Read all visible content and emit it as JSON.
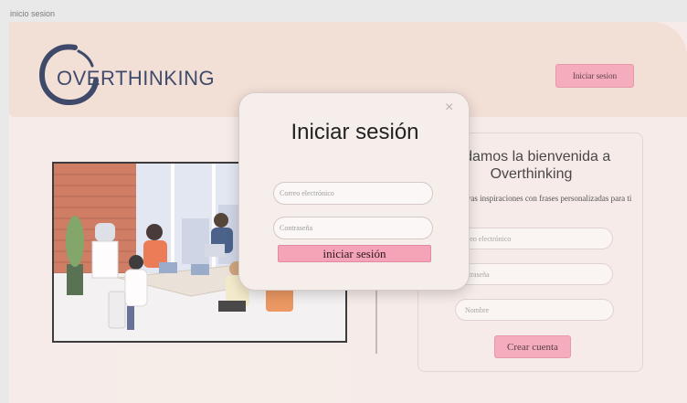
{
  "window": {
    "title": "inicio sesion"
  },
  "header": {
    "logo_text": "OVERTHINKING",
    "login_button": "Iniciar sesion"
  },
  "signup": {
    "title": "e damos la bienvenida a Overthinking",
    "subtitle": "entra nuevas inspiraciones con frases personalizadas para ti",
    "email_placeholder": "rreo electrónico",
    "password_placeholder": "ntraseña",
    "name_placeholder": "Nombre",
    "create_button": "Crear cuenta"
  },
  "modal": {
    "title": "Iniciar sesión",
    "email_placeholder": "Correo electrónico",
    "password_placeholder": "Contraseña",
    "submit_button": "iniciar sesión",
    "close_glyph": "×"
  },
  "colors": {
    "accent_pink": "#f5a3b6",
    "brand_navy": "#1f2e55",
    "page_bg": "#f6ece8",
    "header_bg": "#f1ddd3"
  },
  "icons": {
    "logo": "logo-ring-icon",
    "close": "close-icon"
  }
}
